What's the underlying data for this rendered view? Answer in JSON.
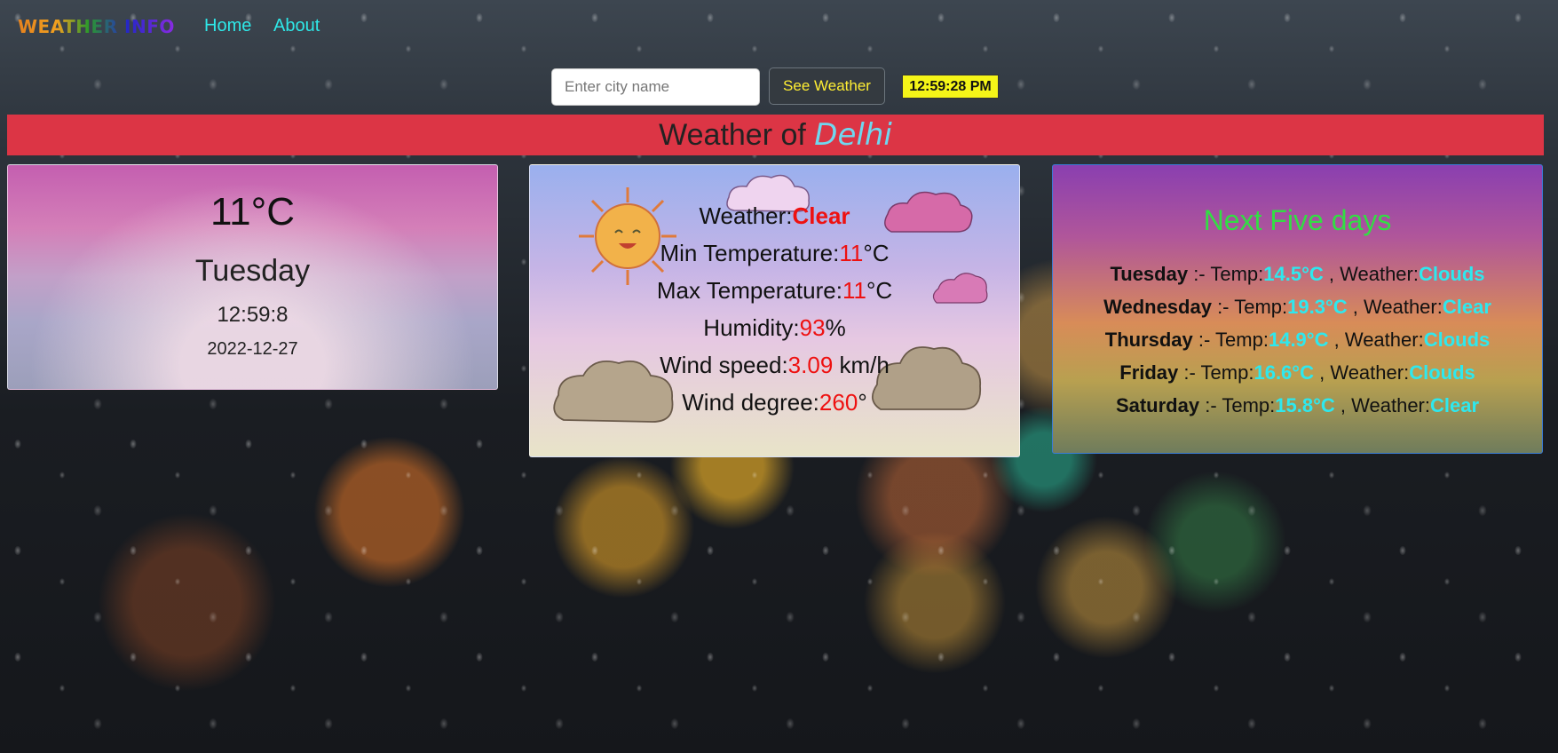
{
  "navbar": {
    "brand": "WEATHER INFO",
    "links": [
      "Home",
      "About"
    ]
  },
  "search": {
    "placeholder": "Enter city name",
    "button_label": "See Weather",
    "clock": "12:59:28 PM"
  },
  "banner": {
    "prefix": "Weather of",
    "city": "Delhi"
  },
  "current": {
    "temperature": "11°C",
    "day": "Tuesday",
    "time": "12:59:8",
    "date": "2022-12-27"
  },
  "details": {
    "weather_label": "Weather:",
    "weather_value": "Clear",
    "min_label": "Min Temperature:",
    "min_value": "11",
    "min_unit": "°C",
    "max_label": "Max Temperature:",
    "max_value": "11",
    "max_unit": "°C",
    "humidity_label": "Humidity:",
    "humidity_value": "93",
    "humidity_unit": "%",
    "wind_speed_label": "Wind speed:",
    "wind_speed_value": "3.09",
    "wind_speed_unit": " km/h",
    "wind_degree_label": "Wind degree:",
    "wind_degree_value": "260",
    "wind_degree_unit": "°"
  },
  "forecast": {
    "heading": "Next Five days",
    "temp_label": "Temp:",
    "weather_label": "Weather:",
    "separator": " :- ",
    "comma": " , ",
    "days": [
      {
        "day": "Tuesday",
        "temp": "14.5°C",
        "weather": "Clouds"
      },
      {
        "day": "Wednesday",
        "temp": "19.3°C",
        "weather": "Clear"
      },
      {
        "day": "Thursday",
        "temp": "14.9°C",
        "weather": "Clouds"
      },
      {
        "day": "Friday",
        "temp": "16.6°C",
        "weather": "Clouds"
      },
      {
        "day": "Saturday",
        "temp": "15.8°C",
        "weather": "Clear"
      }
    ]
  },
  "colors": {
    "banner": "#dc3545",
    "highlight_red": "#ee1111",
    "highlight_cyan": "#2ee8ee",
    "heading_green": "#33dd44",
    "clock_bg": "#f5f518"
  }
}
